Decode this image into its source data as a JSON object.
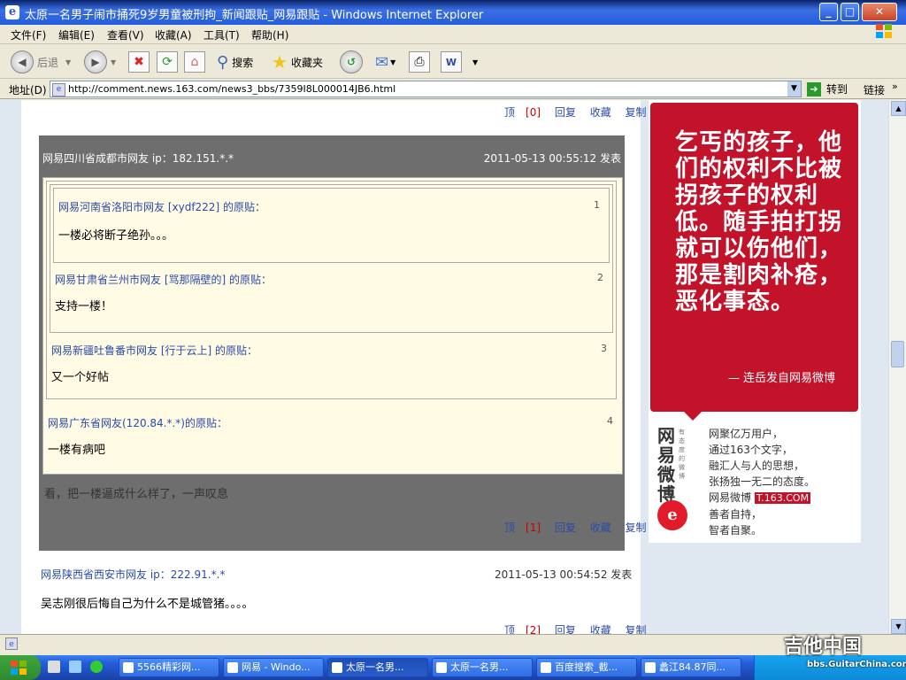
{
  "window": {
    "title": "太原一名男子闹市捅死9岁男童被刑拘_新闻跟贴_网易跟贴 - Windows Internet Explorer"
  },
  "menu": {
    "items": [
      "文件(F)",
      "编辑(E)",
      "查看(V)",
      "收藏(A)",
      "工具(T)",
      "帮助(H)"
    ]
  },
  "toolbar": {
    "back": "后退",
    "search": "搜索",
    "favorites": "收藏夹"
  },
  "address": {
    "label": "地址(D)",
    "url": "http://comment.news.163.com/news3_bbs/7359I8L000014JB6.html",
    "go": "转到",
    "links": "链接"
  },
  "post_top_actions": {
    "up": "顶",
    "up_count": "[0]",
    "reply": "回复",
    "fav": "收藏",
    "copy": "复制"
  },
  "reply": {
    "author": "网易四川省成都市网友 ip：182.151.*.*",
    "time": "2011-05-13 00:55:12 发表",
    "quotes": [
      {
        "num": "1",
        "author": "网易河南省洛阳市网友 [xydf222] 的原贴：",
        "text": "一楼必将断子绝孙。。。"
      },
      {
        "num": "2",
        "author": "网易甘肃省兰州市网友 [骂那隔壁的] 的原贴：",
        "text": "支持一楼！"
      },
      {
        "num": "3",
        "author": "网易新疆吐鲁番市网友 [行于云上] 的原贴：",
        "text": "又一个好帖"
      },
      {
        "num": "4",
        "author": "网易广东省网友(120.84.*.*)的原贴：",
        "text": "一楼有病吧"
      }
    ],
    "body": "看，把一楼逼成什么样了，一声叹息",
    "actions": {
      "up": "顶",
      "up_count": "[1]",
      "reply": "回复",
      "fav": "收藏",
      "copy": "复制"
    }
  },
  "post2": {
    "author": "网易陕西省西安市网友 ip：222.91.*.*",
    "time": "2011-05-13 00:54:52 发表",
    "body": "吴志刚很后悔自己为什么不是城管猪。。。。",
    "actions": {
      "up": "顶",
      "up_count": "[2]",
      "reply": "回复",
      "fav": "收藏",
      "copy": "复制"
    }
  },
  "ad": {
    "quote": "乞丐的孩子，他们的权利不比被拐孩子的权利低。随手拍打拐就可以伤他们，那是割肉补疮，恶化事态。",
    "signature": "— 连岳发自网易微博",
    "logo": "网易微博",
    "logo_small": "有态度的微博",
    "lines": [
      "网聚亿万用户，",
      "通过163个文字，",
      "融汇人与人的思想，",
      "张扬独一无二的态度。"
    ],
    "brand_prefix": "网易微博 ",
    "brand_tag": "T.163.COM",
    "closing": [
      "善者自持，",
      "智者自聚。"
    ]
  },
  "taskbar": {
    "tasks": [
      "5566精彩网...",
      "网易 - Windo...",
      "太原一名男...",
      "太原一名男...",
      "百度搜索_截...",
      "蠡江84.87同..."
    ]
  },
  "watermark": {
    "text": "吉他中国",
    "url": "bbs.GuitarChina.com"
  }
}
